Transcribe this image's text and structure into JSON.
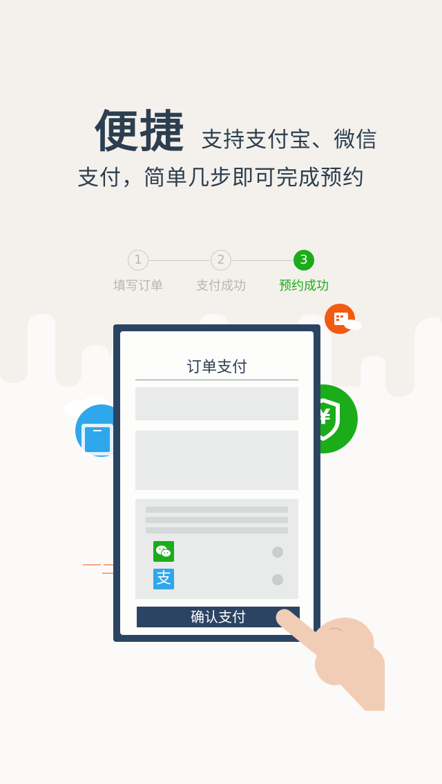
{
  "headline": {
    "big": "便捷",
    "line1": "支持支付宝、微信",
    "line2": "支付，简单几步即可完成预约"
  },
  "steps": [
    {
      "num": "1",
      "label": "填写订单",
      "active": false
    },
    {
      "num": "2",
      "label": "支付成功",
      "active": false
    },
    {
      "num": "3",
      "label": "预约成功",
      "active": true
    }
  ],
  "tablet": {
    "title": "订单支付",
    "confirm_label": "确认支付",
    "wechat_icon": "wechat-icon",
    "alipay_icon": "alipay-icon",
    "alipay_glyph": "支"
  },
  "badges": {
    "shield_symbol": "¥"
  },
  "colors": {
    "accent_green": "#1aad19",
    "navy": "#2c4463",
    "blue": "#2ea7ec",
    "orange": "#f25a12",
    "background": "#f4f1ec"
  }
}
